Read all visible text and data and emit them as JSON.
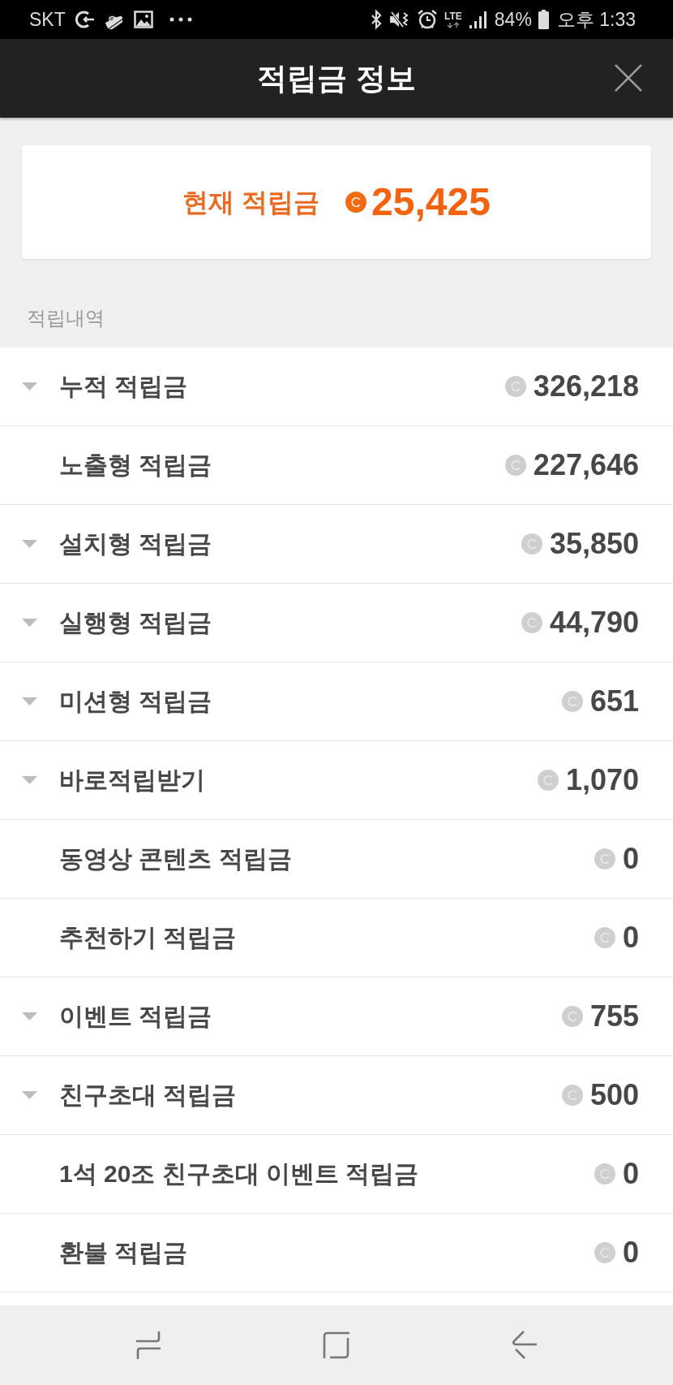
{
  "status_bar": {
    "carrier": "SKT",
    "network": "LTE",
    "battery": "84%",
    "time": "오후 1:33"
  },
  "header": {
    "title": "적립금 정보"
  },
  "balance": {
    "label": "현재 적립금",
    "amount": "25,425"
  },
  "history": {
    "title": "적립내역",
    "rows": [
      {
        "label": "누적 적립금",
        "amount": "326,218",
        "expandable": true
      },
      {
        "label": "노출형 적립금",
        "amount": "227,646",
        "expandable": false
      },
      {
        "label": "설치형 적립금",
        "amount": "35,850",
        "expandable": true
      },
      {
        "label": "실행형 적립금",
        "amount": "44,790",
        "expandable": true
      },
      {
        "label": "미션형 적립금",
        "amount": "651",
        "expandable": true
      },
      {
        "label": "바로적립받기",
        "amount": "1,070",
        "expandable": true
      },
      {
        "label": "동영상 콘텐츠 적립금",
        "amount": "0",
        "expandable": false
      },
      {
        "label": "추천하기 적립금",
        "amount": "0",
        "expandable": false
      },
      {
        "label": "이벤트 적립금",
        "amount": "755",
        "expandable": true
      },
      {
        "label": "친구초대 적립금",
        "amount": "500",
        "expandable": true
      },
      {
        "label": "1석 20조 친구초대 이벤트 적립금",
        "amount": "0",
        "expandable": false
      },
      {
        "label": "환불 적립금",
        "amount": "0",
        "expandable": false
      }
    ]
  }
}
